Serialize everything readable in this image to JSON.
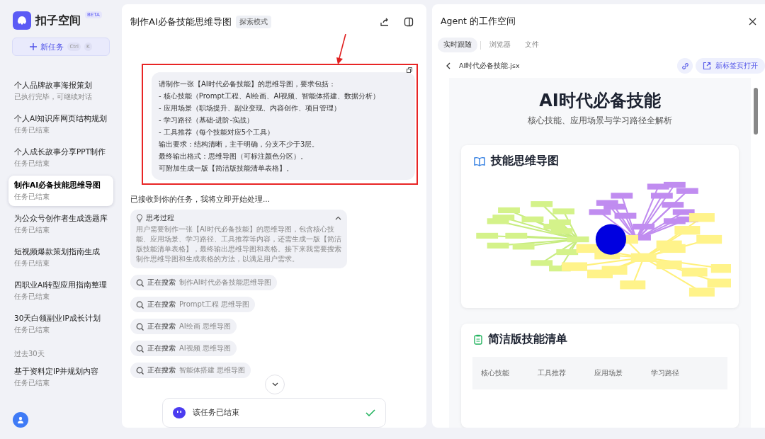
{
  "sidebar": {
    "logo": "扣子空间",
    "badge": "BETA",
    "new_task": {
      "label": "新任务",
      "keys": [
        "Ctrl",
        "K"
      ]
    },
    "groups": [
      {
        "items": [
          {
            "title": "个人品牌故事海报策划",
            "status": "已执行完毕，可继续对话",
            "selected": false
          },
          {
            "title": "个人AI知识库网页结构规划",
            "status": "任务已结束",
            "selected": false
          },
          {
            "title": "个人成长故事分享PPT制作",
            "status": "任务已结束",
            "selected": false
          },
          {
            "title": "制作AI必备技能思维导图",
            "status": "任务已结束",
            "selected": true
          },
          {
            "title": "为公众号创作者生成选题库",
            "status": "任务已结束",
            "selected": false
          },
          {
            "title": "短视频爆款策划指南生成",
            "status": "任务已结束",
            "selected": false
          },
          {
            "title": "四职业AI转型应用指南整理",
            "status": "任务已结束",
            "selected": false
          },
          {
            "title": "30天白领副业IP成长计划",
            "status": "任务已结束",
            "selected": false
          }
        ]
      },
      {
        "label": "过去30天",
        "items": [
          {
            "title": "基于资料定IP并规划内容",
            "status": "任务已结束",
            "selected": false
          }
        ]
      }
    ]
  },
  "chat": {
    "title": "制作AI必备技能思维导图",
    "mode_badge": "探索模式",
    "user_message": [
      "请制作一张【AI时代必备技能】的思维导图，要求包括：",
      "- 核心技能（Prompt工程、AI绘画、AI视频、智能体搭建、数据分析）",
      "- 应用场景（职场提升、副业变现、内容创作、项目管理）",
      "- 学习路径（基础-进阶-实战）",
      "- 工具推荐（每个技能对应5个工具）",
      "输出要求：结构清晰，主干明确，分支不少于3层。",
      "最终输出格式：思维导图（可标注颜色分区）。",
      "可附加生成一版【简洁版技能清单表格】。"
    ],
    "highlighted": true,
    "reply": "已接收到你的任务，我将立即开始处理...",
    "thinking": {
      "title": "思考过程",
      "expanded": true,
      "text": "用户需要制作一张【AI时代必备技能】的思维导图，包含核心技能、应用场景、学习路径、工具推荐等内容，还需生成一版【简洁版技能清单表格】，最终输出思维导图和表格。接下来我需要搜索制作思维导图和生成表格的方法，以满足用户需求。"
    },
    "searches": [
      {
        "label": "正在搜索",
        "query": "制作AI时代必备技能思维导图"
      },
      {
        "label": "正在搜索",
        "query": "Prompt工程 思维导图"
      },
      {
        "label": "正在搜索",
        "query": "AI绘画 思维导图"
      },
      {
        "label": "正在搜索",
        "query": "AI视频 思维导图"
      },
      {
        "label": "正在搜索",
        "query": "智能体搭建 思维导图"
      }
    ],
    "status": {
      "text": "该任务已结束",
      "done": true
    }
  },
  "workspace": {
    "title": "Agent 的工作空间",
    "tabs": [
      {
        "label": "实时跟随",
        "selected": true
      },
      {
        "label": "浏览器",
        "selected": false
      },
      {
        "label": "文件",
        "selected": false
      }
    ],
    "file_name": "AI时代必备技能.jsx",
    "open_button": "新标签页打开",
    "preview": {
      "title": "AI时代必备技能",
      "subtitle": "核心技能、应用场景与学习路径全解析",
      "mindmap_card": {
        "title": "技能思维导图"
      },
      "table_card": {
        "title": "简洁版技能清单",
        "columns": [
          "核心技能",
          "工具推荐",
          "应用场景",
          "学习路径"
        ]
      }
    }
  }
}
